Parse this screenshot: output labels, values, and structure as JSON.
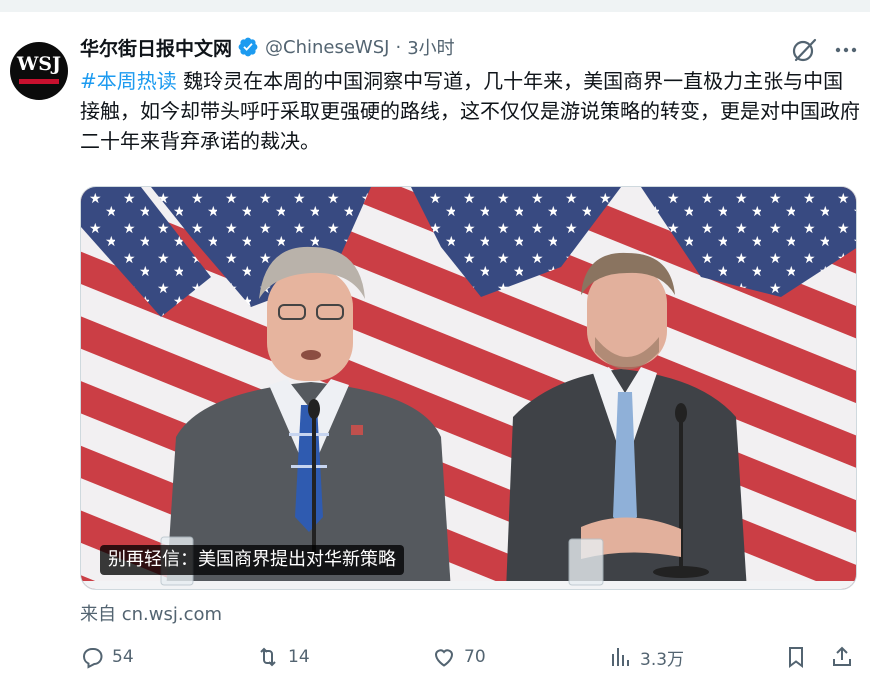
{
  "tweet": {
    "author": {
      "display_name": "华尔街日报中文网",
      "handle": "@ChineseWSJ",
      "avatar_text": "WSJ",
      "verified_icon": "verified-badge-icon"
    },
    "separator": "·",
    "time": "3小时",
    "hashtag": "#本周热读",
    "body": " 魏玲灵在本周的中国洞察中写道，几十年来，美国商界一直极力主张与中国接触，如今却带头呼吁采取更强硬的路线，这不仅仅是游说策略的转变，更是对中国政府二十年来背弃承诺的裁决。",
    "media": {
      "caption": "别再轻信：美国商界提出对华新策略"
    },
    "source": "来自 cn.wsj.com",
    "actions": {
      "reply_count": "54",
      "retweet_count": "14",
      "like_count": "70",
      "view_count": "3.3万"
    }
  },
  "colors": {
    "accent": "#1d9bf0",
    "text_primary": "#0f1419",
    "text_secondary": "#536471"
  },
  "icons": [
    "grok-icon",
    "more-icon",
    "reply-icon",
    "retweet-icon",
    "like-icon",
    "views-icon",
    "bookmark-icon",
    "share-icon"
  ]
}
